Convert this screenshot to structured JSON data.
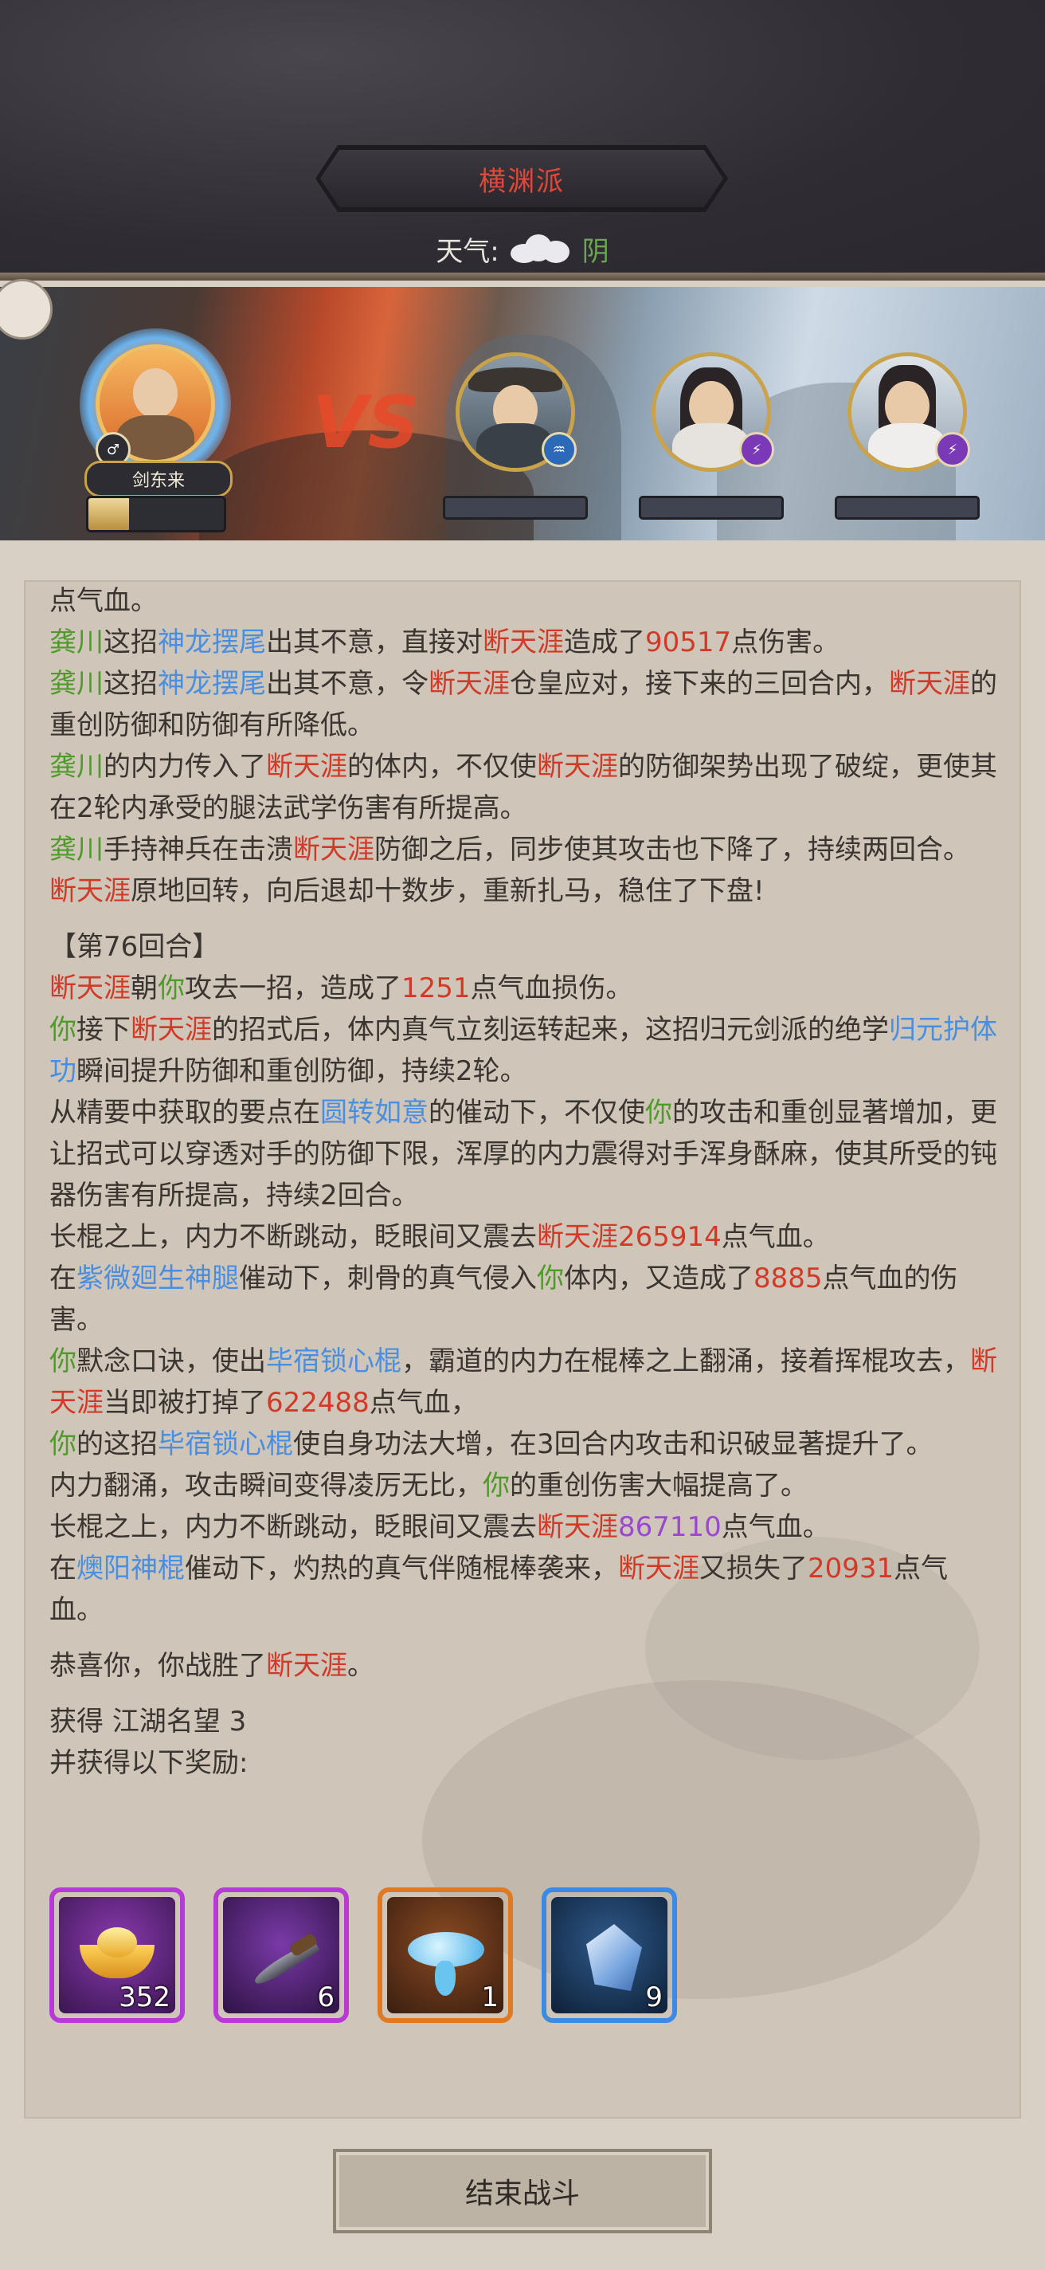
{
  "header": {
    "sect_name": "横渊派",
    "weather_label": "天气:",
    "weather_value": "阴",
    "weather_icon": "cloud-icon"
  },
  "battle": {
    "player_name": "剑东来",
    "player_hp_fraction": 0.3,
    "vs_text": "VS",
    "enemies": [
      {
        "icon": "portrait-straw-hat-swordsman"
      },
      {
        "icon": "portrait-long-hair-swordsman"
      },
      {
        "icon": "portrait-white-robed-swordsman"
      }
    ]
  },
  "log": {
    "l1": "点气血。",
    "l2": {
      "a": "龚川",
      "b": "这招",
      "c": "神龙摆尾",
      "d": "出其不意，直接对",
      "e": "断天涯",
      "f": "造成了",
      "g": "90517",
      "h": "点伤害。"
    },
    "l3": {
      "a": "龚川",
      "b": "这招",
      "c": "神龙摆尾",
      "d": "出其不意，令",
      "e": "断天涯",
      "f": "仓皇应对，接下来的三回合内，",
      "g": "断天涯",
      "h": "的重创防御和防御有所降低。"
    },
    "l4": {
      "a": "龚川",
      "b": "的内力传入了",
      "c": "断天涯",
      "d": "的体内，不仅使",
      "e": "断天涯",
      "f": "的防御架势出现了破绽，更使其在2轮内承受的腿法武学伤害有所提高。"
    },
    "l5": {
      "a": "龚川",
      "b": "手持神兵在击溃",
      "c": "断天涯",
      "d": "防御之后，同步使其攻击也下降了，持续两回合。"
    },
    "l6": {
      "a": "断天涯",
      "b": "原地回转，向后退却十数步，重新扎马，稳住了下盘!"
    },
    "round": "【第76回合】",
    "l7": {
      "a": "断天涯",
      "b": "朝",
      "c": "你",
      "d": "攻去一招，造成了",
      "e": "1251",
      "f": "点气血损伤。"
    },
    "l8": {
      "a": "你",
      "b": "接下",
      "c": "断天涯",
      "d": "的招式后，体内真气立刻运转起来，这招归元剑派的绝学",
      "e": "归元护体功",
      "f": "瞬间提升防御和重创防御，持续2轮。"
    },
    "l9": {
      "a": "从精要中获取的要点在",
      "b": "圆转如意",
      "c": "的催动下，不仅使",
      "d": "你",
      "e": "的攻击和重创显著增加，更让招式可以穿透对手的防御下限，浑厚的内力震得对手浑身酥麻，使其所受的钝器伤害有所提高，持续2回合。"
    },
    "l10": {
      "a": "长棍之上，内力不断跳动，眨眼间又震去",
      "b": "断天涯",
      "c": "265914",
      "d": "点气血。"
    },
    "l11": {
      "a": "在",
      "b": "紫微廻生神腿",
      "c": "催动下，刺骨的真气侵入",
      "d": "你",
      "e": "体内，又造成了",
      "f": "8885",
      "g": "点气血的伤害。"
    },
    "l12": {
      "a": "你",
      "b": "默念口诀，使出",
      "c": "毕宿锁心棍",
      "d": "，霸道的内力在棍棒之上翻涌，接着挥棍攻去，",
      "e": "断天涯",
      "f": "当即被打掉了",
      "g": "622488",
      "h": "点气血，"
    },
    "l13": {
      "a": "你",
      "b": "的这招",
      "c": "毕宿锁心棍",
      "d": "使自身功法大增，在3回合内攻击和识破显著提升了。"
    },
    "l14": {
      "a": "内力翻涌，攻击瞬间变得凌厉无比，",
      "b": "你",
      "c": "的重创伤害大幅提高了。"
    },
    "l15": {
      "a": "长棍之上，内力不断跳动，眨眼间又震去",
      "b": "断天涯",
      "c": "867110",
      "d": "点气血。"
    },
    "l16": {
      "a": "在",
      "b": "燠阳神棍",
      "c": "催动下，灼热的真气伴随棍棒袭来，",
      "d": "断天涯",
      "e": "又损失了",
      "f": "20931",
      "g": "点气血。"
    },
    "victory": {
      "a": "恭喜你，你战胜了",
      "b": "断天涯",
      "c": "。"
    },
    "gain": {
      "a": "获得 ",
      "b": "江湖名望 3"
    },
    "rewards_label": "并获得以下奖励:"
  },
  "rewards": [
    {
      "icon": "gold-ingot-icon",
      "count": "352",
      "rarity": "#b83ad6"
    },
    {
      "icon": "dagger-icon",
      "count": "6",
      "rarity": "#b83ad6"
    },
    {
      "icon": "swirl-cloud-icon",
      "count": "1",
      "rarity": "#e07a22"
    },
    {
      "icon": "crystal-shard-icon",
      "count": "9",
      "rarity": "#3a8ae6"
    }
  ],
  "end_button": "结束战斗",
  "colors": {
    "ally_green": "#4f9a2a",
    "skill_blue": "#4a8ee0",
    "enemy_red": "#d23a28",
    "crit_purple": "#9a48d0"
  }
}
